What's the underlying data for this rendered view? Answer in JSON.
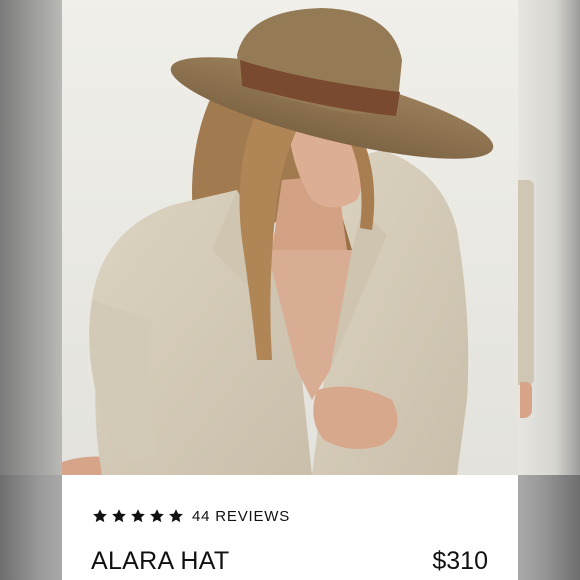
{
  "product": {
    "rating_stars": 5,
    "reviews_label": "44 REVIEWS",
    "name": "ALARA HAT",
    "price": "$310"
  },
  "colors": {
    "hat_felt": "#8c7250",
    "hat_band": "#7a4a30",
    "blazer": "#d4cbb8",
    "background": "#ecebe6",
    "text": "#111111"
  },
  "icons": {
    "rating": "star-icon"
  }
}
